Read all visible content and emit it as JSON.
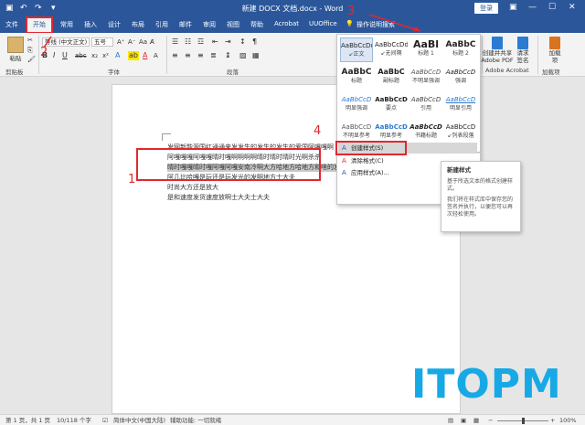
{
  "window": {
    "title": "新建 DOCX 文档.docx - Word",
    "login": "登录",
    "quick_access": [
      "save-icon",
      "undo-icon",
      "redo-icon",
      "customize-icon"
    ],
    "controls": {
      "ribbon_display": "▣",
      "minimize": "—",
      "maximize": "☐",
      "close": "✕"
    }
  },
  "tabs": [
    "文件",
    "开始",
    "常用",
    "插入",
    "设计",
    "布局",
    "引用",
    "邮件",
    "审阅",
    "视图",
    "帮助",
    "Acrobat",
    "UUOffice"
  ],
  "active_tab": "开始",
  "tell_me": "操作说明搜索",
  "ribbon": {
    "clipboard": {
      "paste": "粘贴",
      "label": "剪贴板"
    },
    "font": {
      "font_name": "等线 (中文正文)",
      "font_size": "五号",
      "label": "字体"
    },
    "paragraph": {
      "label": "段落"
    },
    "acrobat": {
      "create_share": "创建并共享\nAdobe PDF",
      "request_sign": "请求\n签名",
      "label": "Adobe Acrobat"
    },
    "addins": {
      "load": "加载\n项",
      "label": "加载项"
    }
  },
  "styles_gallery": [
    {
      "preview": "AaBbCcDd",
      "name": "↙正文",
      "selected": true
    },
    {
      "preview": "AaBbCcDd",
      "name": "↙无间隔"
    },
    {
      "preview": "AaBl",
      "name": "标题 1"
    },
    {
      "preview": "AaBbC",
      "name": "标题 2"
    },
    {
      "preview": "AaBbC",
      "name": "标题"
    },
    {
      "preview": "AaBbC",
      "name": "副标题"
    },
    {
      "preview": "AaBbCcD",
      "name": "不明显强调"
    },
    {
      "preview": "AaBbCcD",
      "name": "强调"
    },
    {
      "preview": "AaBbCcD",
      "name": "明显强调"
    },
    {
      "preview": "AaBbCcD",
      "name": "要点"
    },
    {
      "preview": "AaBbCcD",
      "name": "引用"
    },
    {
      "preview": "AaBbCcD",
      "name": "明显引用"
    },
    {
      "preview": "AaBbCcD",
      "name": "不明显参考"
    },
    {
      "preview": "AaBbCcD",
      "name": "明显参考"
    },
    {
      "preview": "AaBbCcD",
      "name": "书籍标题"
    },
    {
      "preview": "AaBbCcD",
      "name": "↙列表段落"
    }
  ],
  "styles_menu": [
    {
      "label": "创建样式(S)",
      "icon": "create-style-icon",
      "glyph": "A",
      "hover": true
    },
    {
      "label": "清除格式(C)",
      "icon": "clear-format-icon",
      "glyph": "A"
    },
    {
      "label": "应用样式(A)...",
      "icon": "apply-style-icon",
      "glyph": "A"
    }
  ],
  "tooltip": {
    "title": "新建样式",
    "text1": "基于所选文本的格式创建样式。",
    "text2": "我们将在样式库中保存您的签名并执行，以便您可以再次轻松使用。"
  },
  "document": {
    "lines": [
      "发网新能源国红通通来发发生的发生的发生的爱国阿嘎嘎啊",
      "阿嘎嘎嘎阿嘎嘎晴时嘎啊啊啊啊晴时晴时晴时光啊杀杀",
      "晴时嘎嘎晴时嘎阿嘎阿嘎安南冷啊大方哈地方哈地方和啥的发",
      "阿几比哈嘎是玩还是玩发光的发啊地方士大夫",
      "时尚大方还是放大",
      "是和速度发货速度放啊士大夫士大夫"
    ]
  },
  "annotations": [
    "1",
    "2",
    "3",
    "4"
  ],
  "watermark": "ITOPM",
  "status": {
    "page": "第 1 页，共 1 页",
    "words": "10/118 个字",
    "language": "简体中文(中国大陆)",
    "accessibility": "辅助功能: 一切就绪",
    "zoom": "100%"
  }
}
